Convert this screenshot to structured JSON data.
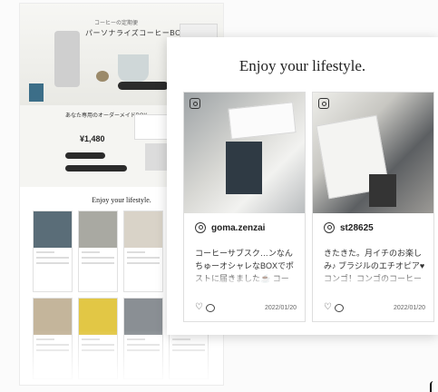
{
  "preview": {
    "hero_tag_small": "コーヒーの定期便",
    "hero_tag_main": "パーソナライズコーヒーBOX",
    "hero_tag_sub": "コーヒーの定期便",
    "sec2_title": "あなた専用のオーダーメイドBOX",
    "sec2_price": "¥1,480",
    "mini_heading": "Enjoy your lifestyle."
  },
  "panel": {
    "title": "Enjoy your lifestyle.",
    "posts": [
      {
        "username": "goma.zenzai",
        "text": "コーヒーサブスク…ンなんちゅーオシャレなBOXでポストに届きました☕ コーヒーメイドフーユーてね。味も香りも",
        "date": "2022/01/20"
      },
      {
        "username": "st28625",
        "text": "きたきた。月イチのお楽しみ♪ ブラジルのエチオピア♥ コンゴ！コンゴのコーヒーはお初…なな…色々いうか国まで初めて",
        "date": "2022/01/20"
      }
    ]
  }
}
